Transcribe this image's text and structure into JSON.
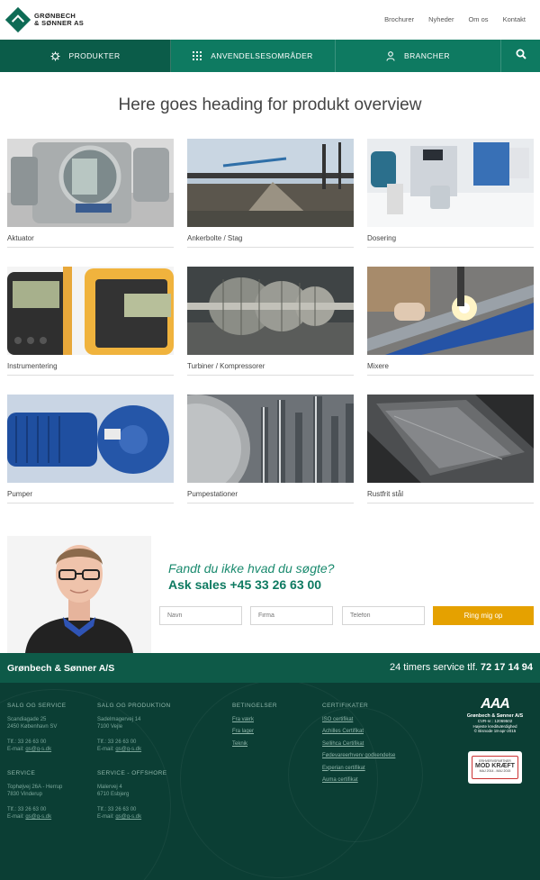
{
  "header": {
    "logo_line1": "GRØNBECH",
    "logo_line2": "& SØNNER AS",
    "links": [
      "Brochurer",
      "Nyheder",
      "Om os",
      "Kontakt"
    ]
  },
  "nav": {
    "tabs": [
      {
        "label": "PRODUKTER",
        "icon": "gear-icon"
      },
      {
        "label": "ANVENDELSESOMRÅDER",
        "icon": "grid-icon"
      },
      {
        "label": "BRANCHER",
        "icon": "user-icon"
      }
    ],
    "search_icon": "search-icon"
  },
  "main": {
    "heading": "Here goes heading for produkt overview",
    "products": [
      "Aktuator",
      "Ankerbolte / Stag",
      "Dosering",
      "Instrumentering",
      "Turbiner / Kompressorer",
      "Mixere",
      "Pumper",
      "Pumpestationer",
      "Rustfrit stål"
    ]
  },
  "contact": {
    "question": "Fandt du ikke hvad du søgte?",
    "sales": "Ask sales +45 33 26 63 00",
    "name_placeholder": "Navn",
    "firm_placeholder": "Firma",
    "phone_placeholder": "Telefon",
    "button": "Ring mig op"
  },
  "footer": {
    "company": "Grønbech & Sønner A/S",
    "service_text": "24 timers service tlf.",
    "service_phone": "72 17 14 94",
    "salg_service": {
      "title": "SALG OG SERVICE",
      "lines": [
        "Scandiagade 25",
        "2450 København SV"
      ],
      "tlf": "Tlf.: 33 26 63 00",
      "email_label": "E-mail:",
      "email": "gs@g-s.dk"
    },
    "salg_produktion": {
      "title": "SALG OG PRODUKTION",
      "lines": [
        "Sadelmagervej 14",
        "7100 Vejle"
      ],
      "tlf": "Tlf.: 33 26 63 00",
      "email_label": "E-mail:",
      "email": "gs@g-s.dk"
    },
    "service": {
      "title": "SERVICE",
      "lines": [
        "Tophøjvej 26A - Herrup",
        "7830 Vinderup"
      ],
      "tlf": "Tlf.: 33 26 63 00",
      "email_label": "E-mail:",
      "email": "gs@g-s.dk"
    },
    "service_offshore": {
      "title": "SERVICE - OFFSHORE",
      "lines": [
        "Malervej 4",
        "6710 Esbjerg"
      ],
      "tlf": "Tlf.: 33 26 63 00",
      "email_label": "E-mail:",
      "email": "gs@g-s.dk"
    },
    "betingelser": {
      "title": "BETINGELSER",
      "links": [
        "Fra værk",
        "Fra lager",
        "Teknik"
      ]
    },
    "certifikater": {
      "title": "CERTIFIKATER",
      "links": [
        "ISO certifikat",
        "Achilles Certifikat",
        "Sellihca Certifikat",
        "Fødevareerhverv godkendelse",
        "Experian certifikat",
        "Auma certifikat"
      ]
    },
    "aaa": {
      "rating": "AAA",
      "company": "Grønbech & Sønner A/S",
      "cvr": "CVR-nr.: 12069502",
      "line1": "Højeste kreditværdighed",
      "line2": "© Bisnode 18-apr-2015"
    },
    "cancer_badge": {
      "line1": "ERHVERVSPARTNER",
      "line2": "MOD KRÆFT",
      "line3": "MAJ 2014 - MAJ 2015"
    }
  },
  "colors": {
    "brand_green": "#0e7a61",
    "dark_green": "#0b5c49",
    "footer_bg": "#0b3e34",
    "accent_orange": "#e5a100"
  }
}
